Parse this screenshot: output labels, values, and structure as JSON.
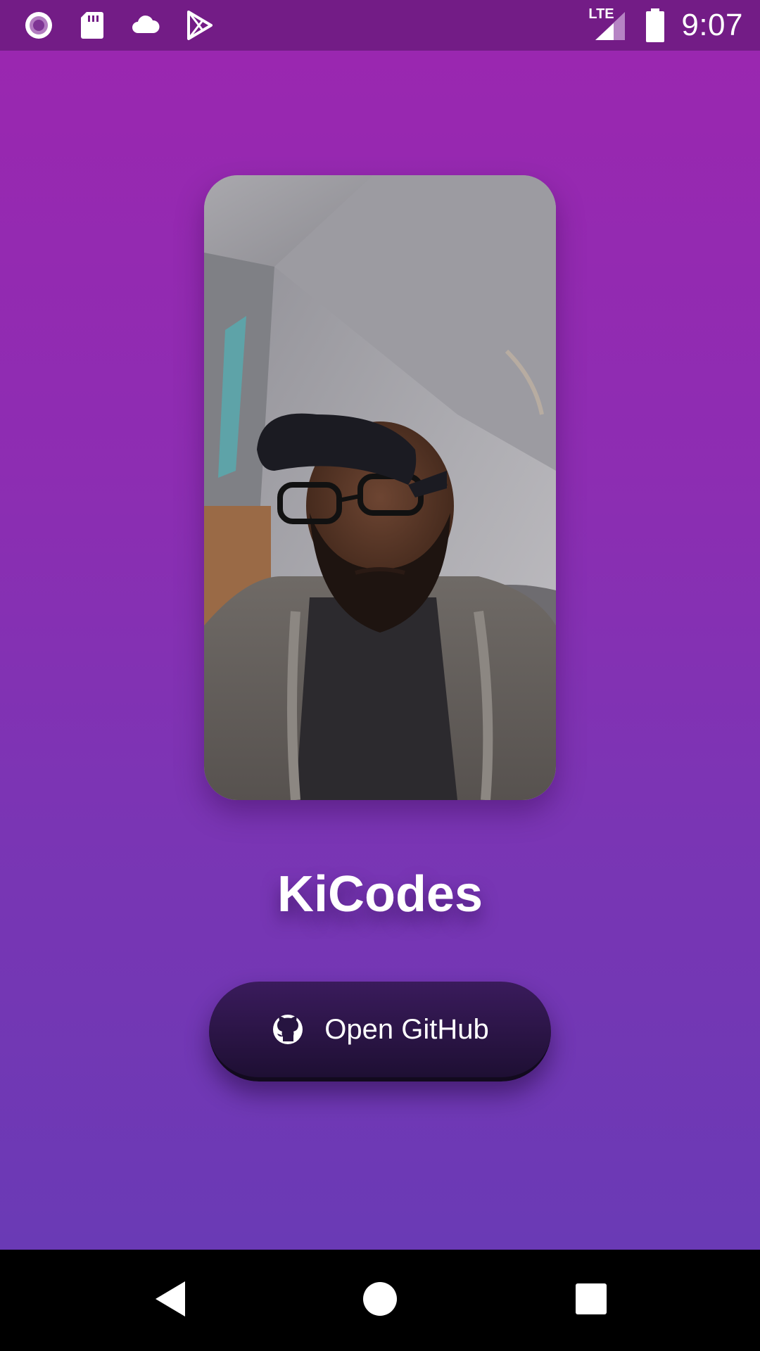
{
  "status_bar": {
    "time": "9:07",
    "network_label": "LTE",
    "left_icons": [
      "podcast-record-icon",
      "sd-card-icon",
      "cloud-icon",
      "play-store-icon"
    ],
    "right_icons": [
      "lte-signal-icon",
      "battery-icon"
    ]
  },
  "profile": {
    "name": "KiCodes"
  },
  "github_button": {
    "icon": "github-icon",
    "label": "Open GitHub"
  },
  "navigation": {
    "buttons": [
      "back-icon",
      "home-icon",
      "recents-icon"
    ]
  },
  "colors": {
    "status_bar": "#731c86",
    "gradient_top": "#9a27b0",
    "gradient_bottom": "#6a3ab5",
    "button_top": "#3a1b5c",
    "button_bottom": "#1e0f33",
    "text": "#ffffff",
    "nav_bar": "#000000"
  }
}
